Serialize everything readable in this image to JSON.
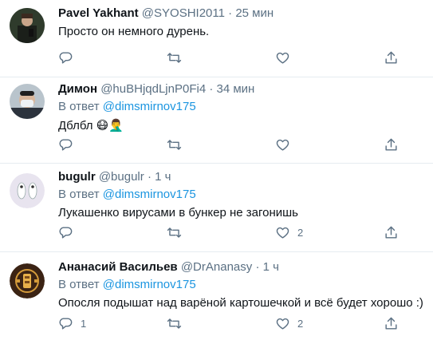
{
  "tweets": [
    {
      "name": "Pavel Yakhant",
      "handle": "@SYOSHI2011",
      "dot": "·",
      "time": "25 мин",
      "reply_prefix": "",
      "reply_to": "",
      "text": "Просто он немного дурень.",
      "emoji": "",
      "reply_count": "",
      "retweet_count": "",
      "like_count": ""
    },
    {
      "name": "Димон",
      "handle": "@huBHjqdLjnP0Fi4",
      "dot": "·",
      "time": "34 мин",
      "reply_prefix": "В ответ ",
      "reply_to": "@dimsmirnov175",
      "text": "Дблбл ",
      "emoji": "😷🤦‍♂️",
      "reply_count": "",
      "retweet_count": "",
      "like_count": ""
    },
    {
      "name": "bugulr",
      "handle": "@bugulr",
      "dot": "·",
      "time": "1 ч",
      "reply_prefix": "В ответ ",
      "reply_to": "@dimsmirnov175",
      "text": "Лукашенко вирусами в бункер не загонишь",
      "emoji": "",
      "reply_count": "",
      "retweet_count": "",
      "like_count": "2"
    },
    {
      "name": "Ананасий Васильев",
      "handle": "@DrAnanasy",
      "dot": "·",
      "time": "1 ч",
      "reply_prefix": "В ответ ",
      "reply_to": "@dimsmirnov175",
      "text": "Опосля подышат над варёной картошечкой и всё будет хорошо :)",
      "emoji": "",
      "reply_count": "1",
      "retweet_count": "",
      "like_count": "2"
    }
  ],
  "icons": {
    "reply": "reply-icon",
    "retweet": "retweet-icon",
    "like": "heart-icon",
    "share": "share-icon"
  },
  "colors": {
    "link": "#1b95e0",
    "secondary": "#5b7083",
    "divider": "#e6ecf0"
  }
}
